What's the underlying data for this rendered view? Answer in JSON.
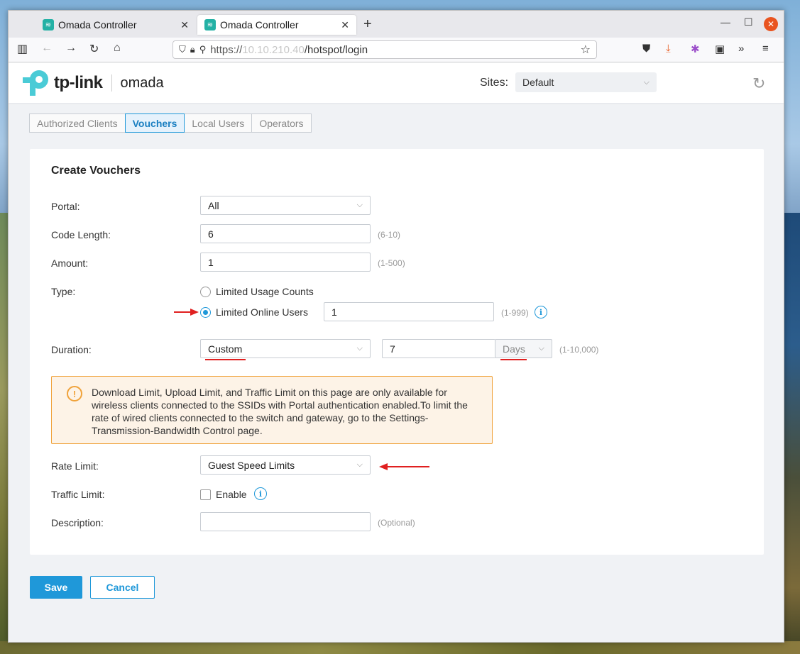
{
  "browser": {
    "tabs": [
      {
        "title": "Omada Controller",
        "close": "✕"
      },
      {
        "title": "Omada Controller",
        "close": "✕"
      }
    ],
    "url": {
      "scheme": "https://",
      "host": "10.10.210.40",
      "path": "/hotspot/login"
    }
  },
  "header": {
    "brand": "tp-link",
    "product": "omada",
    "sites_label": "Sites:",
    "sites_value": "Default"
  },
  "nav_tabs": [
    "Authorized Clients",
    "Vouchers",
    "Local Users",
    "Operators"
  ],
  "form": {
    "title": "Create Vouchers",
    "portal": {
      "label": "Portal:",
      "value": "All"
    },
    "code_length": {
      "label": "Code Length:",
      "value": "6",
      "hint": "(6-10)"
    },
    "amount": {
      "label": "Amount:",
      "value": "1",
      "hint": "(1-500)"
    },
    "type": {
      "label": "Type:",
      "option1": "Limited Usage Counts",
      "option2": "Limited Online Users",
      "selected": "Limited Online Users",
      "users_value": "1",
      "users_hint": "(1-999)"
    },
    "duration": {
      "label": "Duration:",
      "mode": "Custom",
      "value": "7",
      "unit": "Days",
      "hint": "(1-10,000)"
    },
    "warning": "Download Limit, Upload Limit, and Traffic Limit on this page are only available for wireless clients connected to the SSIDs with Portal authentication enabled.To limit the rate of wired clients connected to the switch and gateway, go to the Settings-Transmission-Bandwidth Control page.",
    "rate_limit": {
      "label": "Rate Limit:",
      "value": "Guest Speed Limits"
    },
    "traffic_limit": {
      "label": "Traffic Limit:",
      "checkbox_label": "Enable",
      "checked": false
    },
    "description": {
      "label": "Description:",
      "value": "",
      "hint": "(Optional)"
    }
  },
  "actions": {
    "save": "Save",
    "cancel": "Cancel"
  },
  "colors": {
    "accent": "#1f98d9",
    "warning_border": "#f0a23a",
    "annotation": "#e02020"
  }
}
